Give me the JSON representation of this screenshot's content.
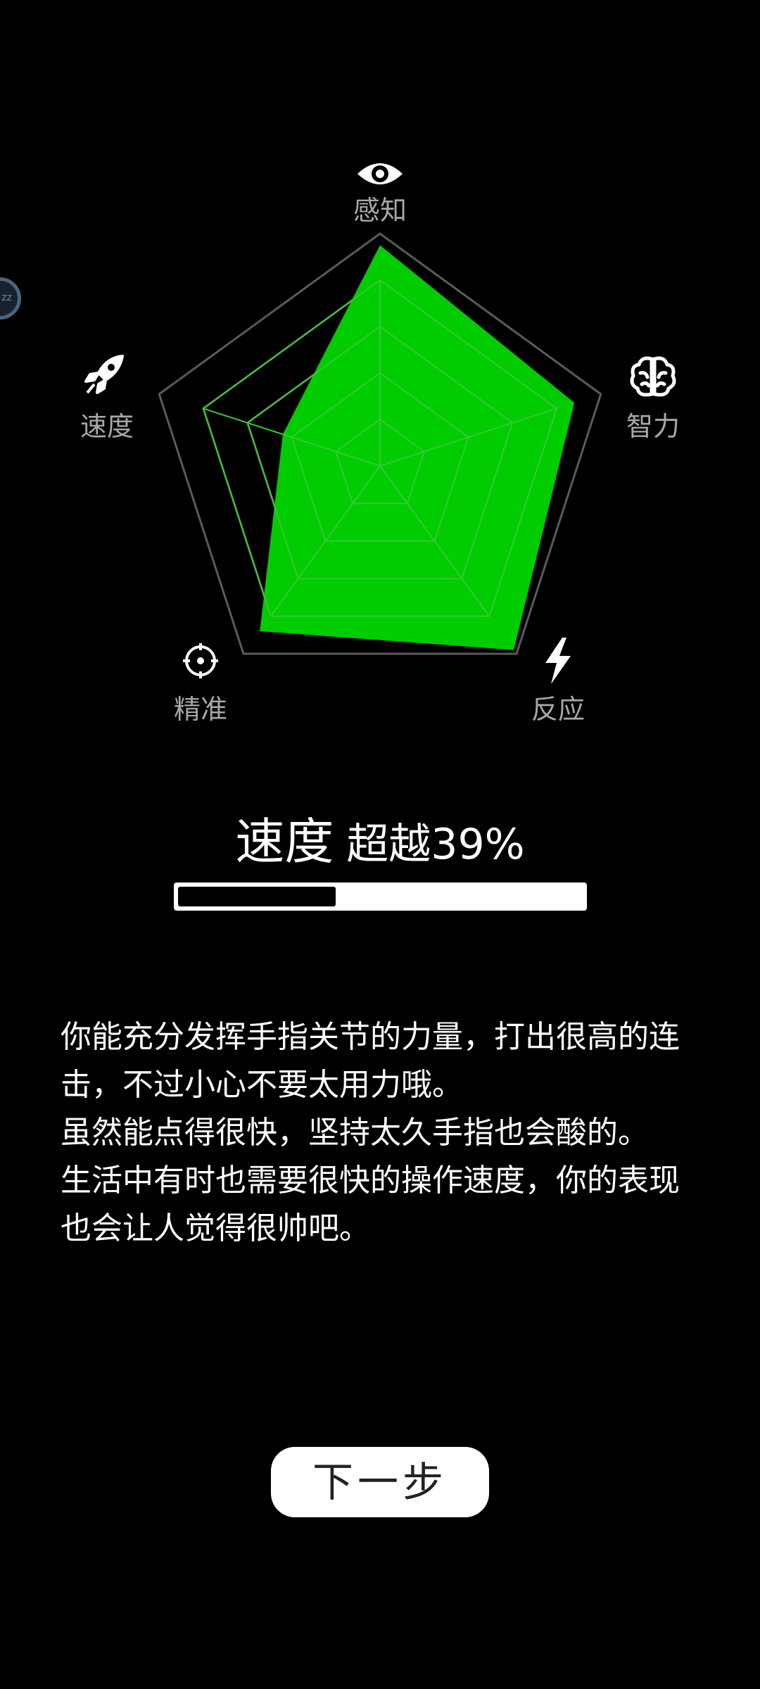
{
  "radar": {
    "axes": [
      {
        "label": "感知",
        "icon": "eye-icon"
      },
      {
        "label": "智力",
        "icon": "brain-icon"
      },
      {
        "label": "反应",
        "icon": "lightning-icon"
      },
      {
        "label": "精准",
        "icon": "crosshair-icon"
      },
      {
        "label": "速度",
        "icon": "rocket-icon"
      }
    ],
    "levels": 5,
    "max": 1,
    "values": [
      0.95,
      0.88,
      0.98,
      0.88,
      0.44
    ],
    "colors": {
      "fill": "#00cc00",
      "grid": "#5a5a5a",
      "inner_grid": "#37c837"
    }
  },
  "side_bubble": {
    "text": "zz"
  },
  "result": {
    "attribute": "速度",
    "rank_text": "超越39%",
    "progress": 0.39
  },
  "description": {
    "paragraphs": [
      "你能充分发挥手指关节的力量，打出很高的连击，不过小心不要太用力哦。",
      "虽然能点得很快，坚持太久手指也会酸的。",
      "生活中有时也需要很快的操作速度，你的表现也会让人觉得很帅吧。"
    ]
  },
  "next_button": {
    "label": "下一步"
  }
}
